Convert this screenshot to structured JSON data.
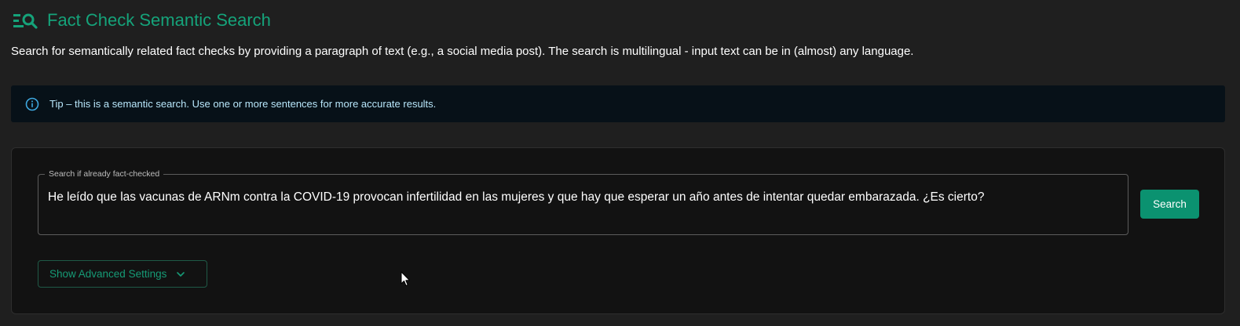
{
  "header": {
    "logo_icon": "search-list-icon",
    "title": "Fact Check Semantic Search",
    "accent_color": "#15a37a"
  },
  "description": "Search for semantically related fact checks by providing a paragraph of text (e.g., a social media post). The search is multilingual - input text can be in (almost) any language.",
  "tip": {
    "icon": "info-icon",
    "text": "Tip – this is a semantic search. Use one or more sentences for more accurate results."
  },
  "search_form": {
    "field_label": "Search if already fact-checked",
    "field_value": "He leído que las vacunas de ARNm contra la COVID-19 provocan infertilidad en las mujeres y que hay que esperar un año antes de intentar quedar embarazada. ¿Es cierto?",
    "search_button_label": "Search",
    "advanced_settings_label": "Show Advanced Settings",
    "advanced_icon": "chevron-down-icon"
  }
}
